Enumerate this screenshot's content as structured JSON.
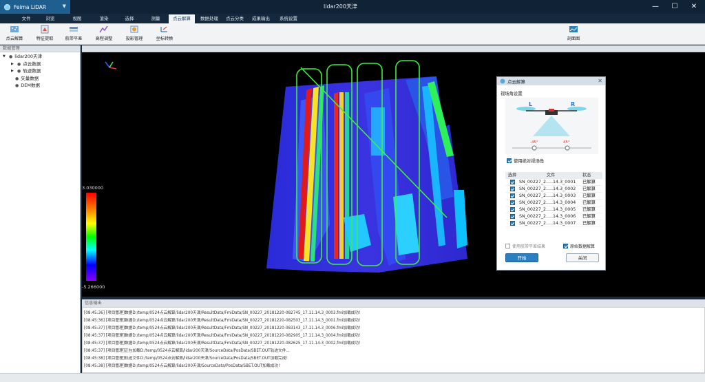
{
  "app": {
    "name": "Feima LiDAR",
    "window_title": "lidar200天津"
  },
  "menu": [
    "文件",
    "浏览",
    "视图",
    "渲染",
    "选择",
    "测量",
    "点云解算",
    "数据处理",
    "点云分类",
    "成果输出",
    "系统设置"
  ],
  "menu_active": "点云解算",
  "toolbar": {
    "tools": [
      "点云解算",
      "特征提取",
      "航带平差",
      "高程调整",
      "投影管理",
      "坐标转换"
    ],
    "right_tool": "剖面图"
  },
  "data_panel": {
    "title": "数据管理",
    "root": "lidar200天津",
    "children": [
      "点云数据",
      "轨迹数据",
      "矢量数据",
      "DEM数据"
    ]
  },
  "colorbar": {
    "max": "3.030000",
    "min": "-5.266000"
  },
  "dialog": {
    "title": "点云解算",
    "view_angle_label": "视场角设置",
    "left_label": "L",
    "right_label": "R",
    "left_angle": "-45°",
    "right_angle": "45°",
    "abs_angle": "使用绝对视场角",
    "columns": [
      "选择",
      "文件",
      "状态"
    ],
    "files": [
      {
        "name": "SN_00227_2.....14.3_0001",
        "status": "已解算"
      },
      {
        "name": "SN_00227_2.....14.3_0002",
        "status": "已解算"
      },
      {
        "name": "SN_00227_2.....14.3_0003",
        "status": "已解算"
      },
      {
        "name": "SN_00227_2.....14.3_0004",
        "status": "已解算"
      },
      {
        "name": "SN_00227_2.....14.3_0005",
        "status": "已解算"
      },
      {
        "name": "SN_00227_2.....14.3_0006",
        "status": "已解算"
      },
      {
        "name": "SN_00227_2.....14.3_0007",
        "status": "已解算"
      }
    ],
    "opt_smooth": "使用航带平差结果",
    "opt_raw": "原始数据解算",
    "start_btn": "开始",
    "close_btn": "关闭"
  },
  "info": {
    "title": "信息输出",
    "lines": [
      "[08:45:36] [项目管理]数据D:/temp/0524点云解算/lidar200天津/ResultData/FmiData/SN_00227_20181220-082745_17.11.14.3_0003.fmi加载成功！",
      "[08:45:36] [项目管理]数据D:/temp/0524点云解算/lidar200天津/ResultData/FmiData/SN_00227_20181220-082503_17.11.14.3_0001.fmi加载成功！",
      "[08:45:37] [项目管理]数据D:/temp/0524点云解算/lidar200天津/ResultData/FmiData/SN_00227_20181220-083143_17.11.14.3_0006.fmi加载成功！",
      "[08:45:37] [项目管理]数据D:/temp/0524点云解算/lidar200天津/ResultData/FmiData/SN_00227_20181220-082905_17.11.14.3_0004.fmi加载成功！",
      "[08:45:37] [项目管理]数据D:/temp/0524点云解算/lidar200天津/ResultData/FmiData/SN_00227_20181220-082625_17.11.14.3_0002.fmi加载成功！",
      "[08:45:37] [项目管理]正在加载D:/temp/0524点云解算/lidar200天津/SourceData/PosData/SBET.OUT轨迹文件...",
      "[08:45:38] [项目管理]轨迹文件D:/temp/0524点云解算/lidar200天津/SourceData/PosData/SBET.OUT加载完成！",
      "[08:45:38] [项目管理]数据D:/temp/0524点云解算/lidar200天津/SourceData/PosData/SBET.OUT加载成功！"
    ]
  },
  "colors": {
    "title_bg": "#0f2236",
    "accent": "#2a7fc0",
    "track_green": "#3df03d"
  }
}
